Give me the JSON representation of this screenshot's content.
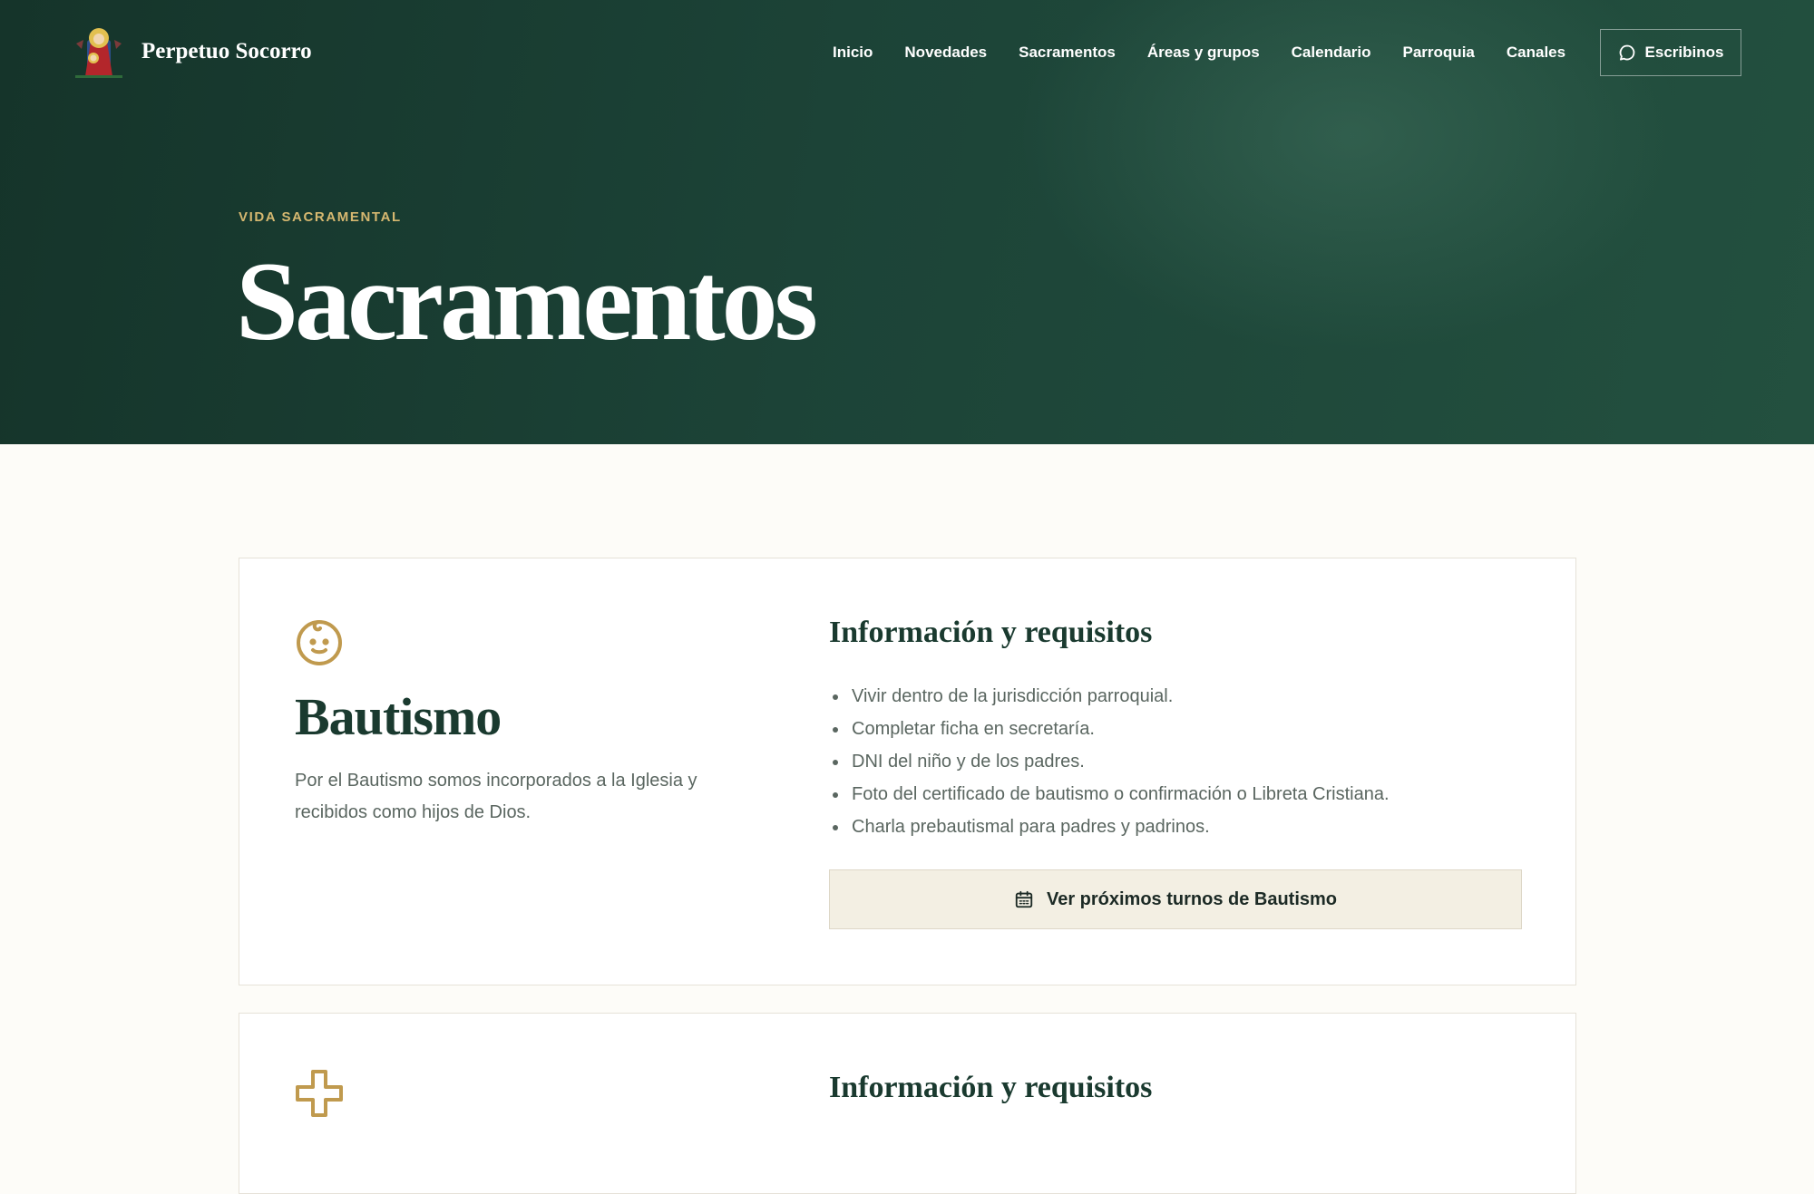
{
  "header": {
    "brand_name": "Perpetuo Socorro",
    "nav": [
      "Inicio",
      "Novedades",
      "Sacramentos",
      "Áreas y grupos",
      "Calendario",
      "Parroquia",
      "Canales"
    ],
    "contact_button": "Escribinos"
  },
  "hero": {
    "eyebrow": "VIDA SACRAMENTAL",
    "title": "Sacramentos"
  },
  "cards": [
    {
      "icon": "baby-face-icon",
      "title": "Bautismo",
      "description": "Por el Bautismo somos incorporados a la Iglesia y recibidos como hijos de Dios.",
      "requirements_title": "Información y requisitos",
      "requirements": [
        "Vivir dentro de la jurisdicción parroquial.",
        "Completar ficha en secretaría.",
        "DNI del niño y de los padres.",
        "Foto del certificado de bautismo o confirmación o Libreta Cristiana.",
        "Charla prebautismal para padres y padrinos."
      ],
      "button": "Ver próximos turnos de Bautismo"
    },
    {
      "icon": "cross-icon",
      "requirements_title": "Información y requisitos"
    }
  ],
  "colors": {
    "hero_green": "#1c4337",
    "accent_gold": "#c09a4e",
    "page_bg": "#fdfcf8",
    "button_bg": "#f3efe3"
  }
}
